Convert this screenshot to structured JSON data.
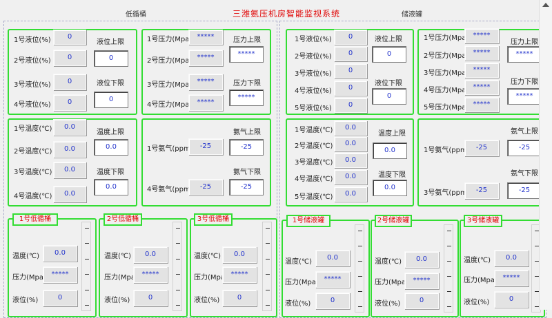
{
  "title": "三潍氨压机房智能监视系统",
  "sections": {
    "left": "低循桶",
    "right": "储液罐"
  },
  "left": {
    "level": {
      "rows": [
        {
          "label": "1号液位(%)",
          "value": "0"
        },
        {
          "label": "2号液位(%)",
          "value": "0"
        },
        {
          "label": "3号液位(%)",
          "value": "0"
        },
        {
          "label": "4号液位(%)",
          "value": "0"
        }
      ],
      "upper_label": "液位上限",
      "upper_value": "0",
      "lower_label": "液位下限",
      "lower_value": "0"
    },
    "pressure": {
      "rows": [
        {
          "label": "1号压力(Mpa)",
          "value": "*****"
        },
        {
          "label": "2号压力(Mpa)",
          "value": "*****"
        },
        {
          "label": "3号压力(Mpa)",
          "value": "*****"
        },
        {
          "label": "4号压力(Mpa)",
          "value": "*****"
        }
      ],
      "upper_label": "压力上限",
      "upper_value": "*****",
      "lower_label": "压力下限",
      "lower_value": "*****"
    },
    "temperature": {
      "rows": [
        {
          "label": "1号温度(℃)",
          "value": "0.0"
        },
        {
          "label": "2号温度(℃)",
          "value": "0.0"
        },
        {
          "label": "3号温度(℃)",
          "value": "0.0"
        },
        {
          "label": "4号温度(℃)",
          "value": "0.0"
        }
      ],
      "upper_label": "温度上限",
      "upper_value": "0.0",
      "lower_label": "温度下限",
      "lower_value": "0.0"
    },
    "ammonia": {
      "rows": [
        {
          "label": "1号氨气(ppm)",
          "value": "-25"
        },
        {
          "label": "4号氨气(ppm)",
          "value": "-25"
        }
      ],
      "upper_label": "氨气上限",
      "upper_value": "-25",
      "lower_label": "氨气下限",
      "lower_value": "-25"
    },
    "units": [
      {
        "name": "1号低循桶",
        "temp_label": "温度(℃)",
        "temp": "0.0",
        "press_label": "压力(Mpa)",
        "press": "*****",
        "level_label": "液位(%)",
        "level": "0"
      },
      {
        "name": "2号低循桶",
        "temp_label": "温度(℃)",
        "temp": "0.0",
        "press_label": "压力(Mpa",
        "press": "*****",
        "level_label": "液位(%)",
        "level": "0"
      },
      {
        "name": "3号低循桶",
        "temp_label": "温度(℃)",
        "temp": "0.0",
        "press_label": "压力(Mpa",
        "press": "*****",
        "level_label": "液位(%)",
        "level": "0"
      }
    ]
  },
  "right": {
    "level": {
      "rows": [
        {
          "label": "1号液位(%)",
          "value": "0"
        },
        {
          "label": "2号液位(%)",
          "value": "0"
        },
        {
          "label": "3号液位(%)",
          "value": "0"
        },
        {
          "label": "4号液位(%)",
          "value": "0"
        },
        {
          "label": "5号液位(%)",
          "value": "0"
        }
      ],
      "upper_label": "液位上限",
      "upper_value": "0",
      "lower_label": "液位下限",
      "lower_value": "0"
    },
    "pressure": {
      "rows": [
        {
          "label": "1号压力(Mpa)",
          "value": "*****"
        },
        {
          "label": "2号压力(Mpa)",
          "value": "*****"
        },
        {
          "label": "3号压力(Mpa)",
          "value": "*****"
        },
        {
          "label": "4号压力(Mpa)",
          "value": "*****"
        },
        {
          "label": "5号压力(Mpa)",
          "value": "*****"
        }
      ],
      "upper_label": "压力上限",
      "upper_value": "*****",
      "lower_label": "压力下限",
      "lower_value": "*****"
    },
    "temperature": {
      "rows": [
        {
          "label": "1号温度(℃)",
          "value": "0.0"
        },
        {
          "label": "2号温度(℃)",
          "value": "0.0"
        },
        {
          "label": "3号温度(℃)",
          "value": "0.0"
        },
        {
          "label": "4号温度(℃)",
          "value": "0.0"
        },
        {
          "label": "5号温度(℃)",
          "value": "0.0"
        }
      ],
      "upper_label": "温度上限",
      "upper_value": "0.0",
      "lower_label": "温度下限",
      "lower_value": "0.0"
    },
    "ammonia": {
      "rows": [
        {
          "label": "1号氨气(ppm)",
          "value": "-25"
        },
        {
          "label": "3号氨气(ppm)",
          "value": "-25"
        }
      ],
      "upper_label": "氨气上限",
      "upper_value": "-25",
      "lower_label": "氨气下限",
      "lower_value": "-25"
    },
    "units": [
      {
        "name": "1号储液罐",
        "temp_label": "温度(℃)",
        "temp": "0.0",
        "press_label": "压力(Mpa)",
        "press": "*****",
        "level_label": "液位(%)",
        "level": "0"
      },
      {
        "name": "2号储液罐",
        "temp_label": "温度(℃)",
        "temp": "0.0",
        "press_label": "压力(Mpa)",
        "press": "*****",
        "level_label": "液位(%)",
        "level": "0"
      },
      {
        "name": "3号储液罐",
        "temp_label": "温度(℃)",
        "temp": "0.0",
        "press_label": "压力(Mpa)",
        "press": "*****",
        "level_label": "液位(%)",
        "level": "0"
      }
    ]
  }
}
